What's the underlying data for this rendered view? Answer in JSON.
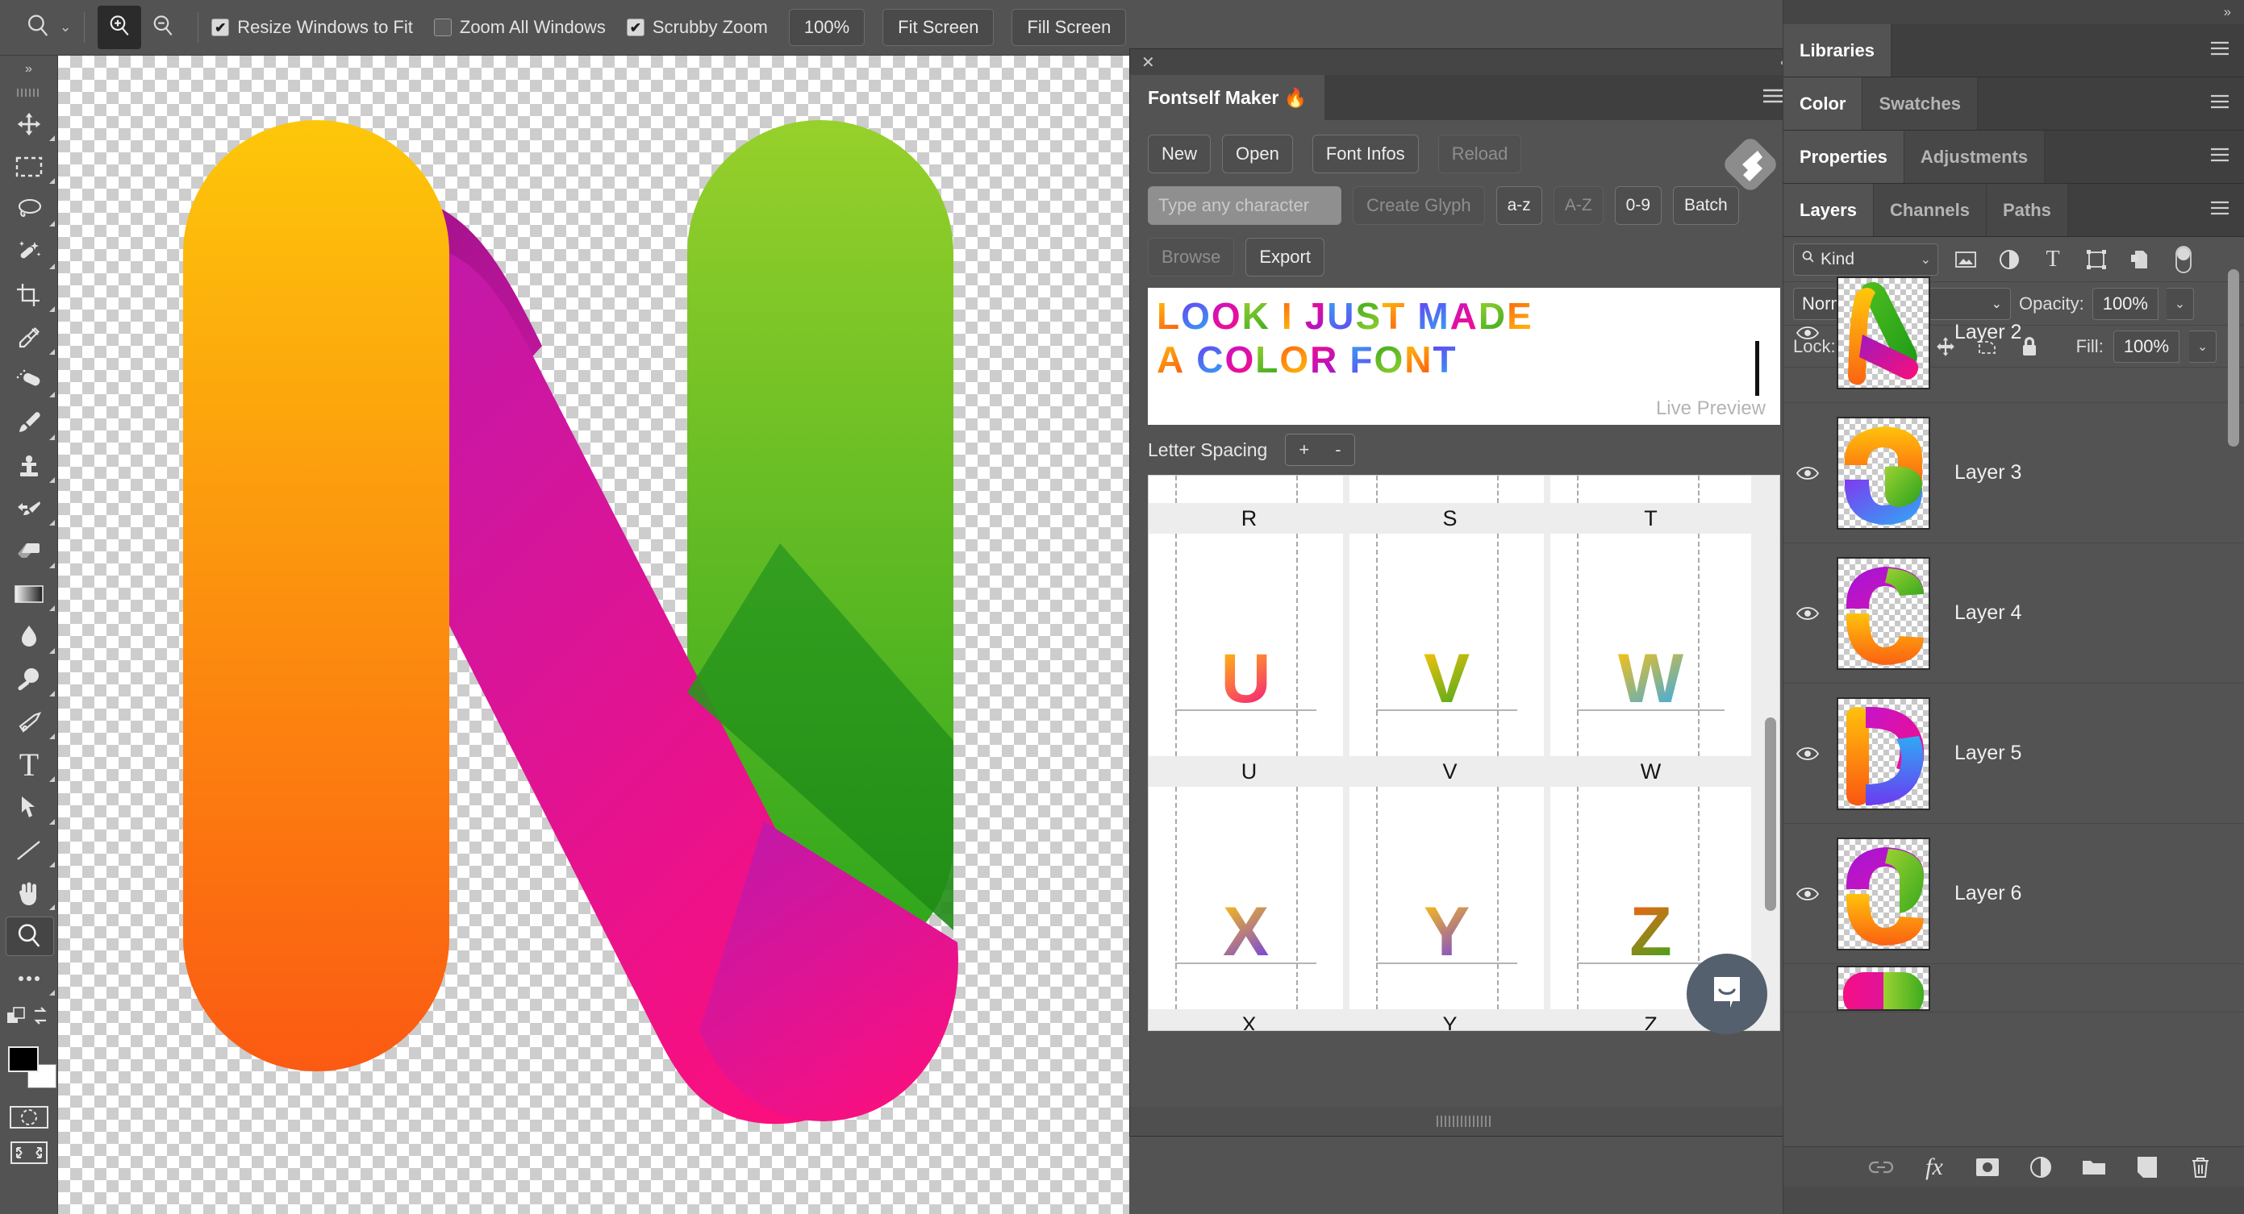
{
  "options_bar": {
    "tool_icon": "zoom-tool-icon",
    "tool_chevron": "⌄",
    "zoom_in_icon": "zoom-in-icon",
    "zoom_out_icon": "zoom-out-icon",
    "checkboxes": [
      {
        "label": "Resize Windows to Fit",
        "checked": true
      },
      {
        "label": "Zoom All Windows",
        "checked": false
      },
      {
        "label": "Scrubby Zoom",
        "checked": true
      }
    ],
    "buttons": [
      "100%",
      "Fit Screen",
      "Fill Screen"
    ],
    "right_icons": [
      "search-icon",
      "workspace-icon",
      "chevron-down-icon"
    ]
  },
  "toolbar": {
    "collapse_glyph": "»",
    "tools": [
      {
        "name": "move-tool",
        "selected": false
      },
      {
        "name": "rectangular-marquee-tool",
        "selected": false
      },
      {
        "name": "lasso-tool",
        "selected": false
      },
      {
        "name": "object-selection-tool",
        "selected": false
      },
      {
        "name": "crop-tool",
        "selected": false
      },
      {
        "name": "eyedropper-tool",
        "selected": false
      },
      {
        "name": "healing-brush-tool",
        "selected": false
      },
      {
        "name": "brush-tool",
        "selected": false
      },
      {
        "name": "clone-stamp-tool",
        "selected": false
      },
      {
        "name": "history-brush-tool",
        "selected": false
      },
      {
        "name": "eraser-tool",
        "selected": false
      },
      {
        "name": "gradient-tool",
        "selected": false
      },
      {
        "name": "blur-tool",
        "selected": false
      },
      {
        "name": "dodge-tool",
        "selected": false
      },
      {
        "name": "pen-tool",
        "selected": false
      },
      {
        "name": "type-tool",
        "selected": false
      },
      {
        "name": "path-selection-tool",
        "selected": false
      },
      {
        "name": "line-shape-tool",
        "selected": false
      },
      {
        "name": "hand-tool",
        "selected": false
      },
      {
        "name": "zoom-tool",
        "selected": true
      },
      {
        "name": "edit-toolbar-tool",
        "selected": false
      }
    ],
    "foreground_color": "#000000",
    "background_color": "#ffffff",
    "quick_mask_icon": "quick-mask-icon",
    "screen_mode_icon": "screen-mode-icon"
  },
  "canvas": {
    "document_letter": "N",
    "colors": {
      "orange_top": "#FCC70B",
      "orange_bottom": "#FB5C12",
      "magenta_top": "#C318A8",
      "magenta_bottom": "#FB0F7E",
      "green_top": "#96CF2C",
      "green_bottom": "#2BA51C"
    }
  },
  "fontself": {
    "close_glyph": "✕",
    "collapse_glyph": "‹‹",
    "tab_title": "Fontself Maker 🔥",
    "menu_icon": "hamburger-icon",
    "logo_icon": "fontself-logo-icon",
    "row1": [
      {
        "label": "New",
        "enabled": true
      },
      {
        "label": "Open",
        "enabled": true
      },
      {
        "label": "Font Infos",
        "enabled": true
      },
      {
        "label": "Reload",
        "enabled": false
      }
    ],
    "glyph_input_placeholder": "Type any character",
    "glyph_input_value": "",
    "row2": [
      {
        "label": "Create Glyph",
        "enabled": false
      },
      {
        "label": "a-z",
        "enabled": true
      },
      {
        "label": "A-Z",
        "enabled": false
      },
      {
        "label": "0-9",
        "enabled": true
      },
      {
        "label": "Batch",
        "enabled": true
      }
    ],
    "row3": [
      {
        "label": "Browse",
        "enabled": false
      },
      {
        "label": "Export",
        "enabled": true
      }
    ],
    "preview": {
      "line1": "LOOK I JUST MADE",
      "line2": "A COLOR FONT",
      "caption": "Live Preview"
    },
    "letter_spacing": {
      "label": "Letter Spacing",
      "plus": "+",
      "minus": "-"
    },
    "glyph_grid": {
      "rows": [
        {
          "labels": [
            "R",
            "S",
            "T"
          ],
          "letters": [
            "",
            "",
            ""
          ]
        },
        {
          "labels": [
            "U",
            "V",
            "W"
          ],
          "letters": [
            "U",
            "V",
            "W"
          ]
        },
        {
          "labels": [
            "X",
            "Y",
            "Z"
          ],
          "letters": [
            "X",
            "Y",
            "Z"
          ]
        }
      ]
    },
    "chat_icon": "chat-bubble-icon"
  },
  "right_dock": {
    "collapse_glyph": "››",
    "panel_groups": [
      {
        "tabs": [
          {
            "label": "Libraries",
            "active": true
          }
        ]
      },
      {
        "tabs": [
          {
            "label": "Color",
            "active": true
          },
          {
            "label": "Swatches",
            "active": false
          }
        ]
      },
      {
        "tabs": [
          {
            "label": "Properties",
            "active": true
          },
          {
            "label": "Adjustments",
            "active": false
          }
        ]
      },
      {
        "tabs": [
          {
            "label": "Layers",
            "active": true
          },
          {
            "label": "Channels",
            "active": false
          },
          {
            "label": "Paths",
            "active": false
          }
        ]
      }
    ],
    "layers_panel": {
      "filter": {
        "search_icon": "search-icon",
        "kind_label": "Kind",
        "chevron": "⌄",
        "filter_icons": [
          "pixel-layer-filter-icon",
          "adjustment-layer-filter-icon",
          "type-layer-filter-icon",
          "shape-layer-filter-icon",
          "smart-object-filter-icon"
        ],
        "toggle_icon": "filter-toggle-icon"
      },
      "blend_mode": "Normal",
      "blend_chevron": "⌄",
      "opacity_label": "Opacity:",
      "opacity_value": "100%",
      "lock_label": "Lock:",
      "lock_icons": [
        "lock-transparent-pixels-icon",
        "lock-image-pixels-icon",
        "lock-position-icon",
        "lock-artboard-nesting-icon",
        "lock-all-icon"
      ],
      "fill_label": "Fill:",
      "fill_value": "100%",
      "layers": [
        {
          "name": "Layer 2",
          "visible": true,
          "thumb_letter": "A"
        },
        {
          "name": "Layer 3",
          "visible": true,
          "thumb_letter": "G"
        },
        {
          "name": "Layer 4",
          "visible": true,
          "thumb_letter": "C"
        },
        {
          "name": "Layer 5",
          "visible": true,
          "thumb_letter": "D"
        },
        {
          "name": "Layer 6",
          "visible": true,
          "thumb_letter": "C"
        },
        {
          "name": "",
          "visible": true,
          "thumb_letter": "O"
        }
      ],
      "bottom_buttons": [
        "link-layers-icon",
        "layer-style-fx-icon",
        "layer-mask-icon",
        "adjustment-layer-icon",
        "new-group-icon",
        "new-layer-icon",
        "delete-layer-icon"
      ]
    }
  }
}
